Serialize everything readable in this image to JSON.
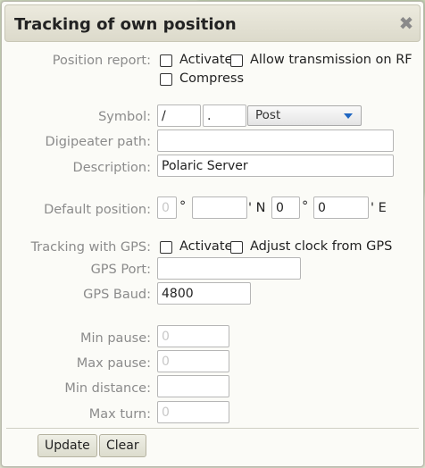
{
  "dialog": {
    "title": "Tracking of own position",
    "close_glyph": "✖"
  },
  "position_report": {
    "label": "Position report:",
    "activate": "Activate",
    "allow_transmission": "Allow transmission on RF",
    "compress": "Compress"
  },
  "symbol": {
    "label": "Symbol:",
    "table_value": "/",
    "symbol_value": ".",
    "selected_option": "Post"
  },
  "digipeater": {
    "label": "Digipeater path:",
    "value": ""
  },
  "description": {
    "label": "Description:",
    "value": "Polaric Server"
  },
  "default_position": {
    "label": "Default position:",
    "lat_deg": "0",
    "deg_sign": "°",
    "lat_min": "",
    "lat_suffix": "' N",
    "lon_deg": "0",
    "lon_min": "0",
    "lon_suffix": "' E"
  },
  "gps": {
    "label": "Tracking with GPS:",
    "activate": "Activate",
    "adjust_clock": "Adjust clock from GPS",
    "port_label": "GPS Port:",
    "port_value": "",
    "baud_label": "GPS Baud:",
    "baud_value": "4800"
  },
  "smart_beaconing": {
    "min_pause_label": "Min pause:",
    "min_pause_value": "0",
    "max_pause_label": "Max pause:",
    "max_pause_value": "0",
    "min_distance_label": "Min distance:",
    "min_distance_value": "",
    "max_turn_label": "Max turn:",
    "max_turn_value": "0"
  },
  "buttons": {
    "update": "Update",
    "clear": "Clear"
  }
}
